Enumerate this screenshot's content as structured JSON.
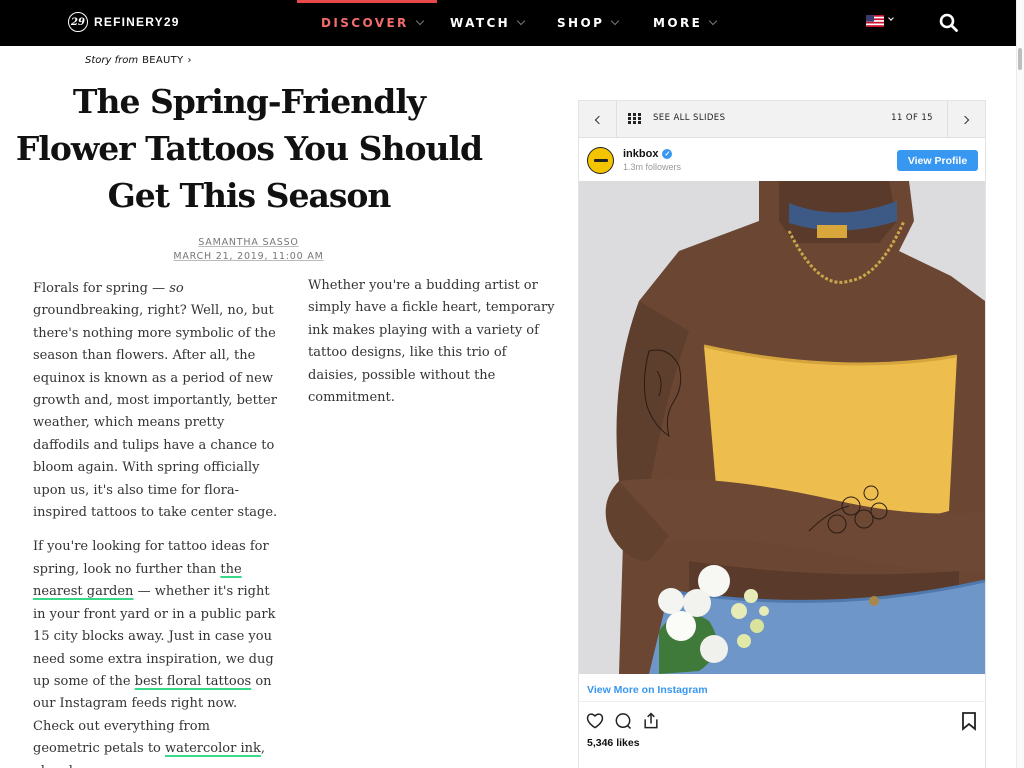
{
  "brand": {
    "logo_mark": "29",
    "name": "REFINERY29"
  },
  "nav": {
    "items": [
      {
        "label": "DISCOVER",
        "active": true
      },
      {
        "label": "WATCH",
        "active": false
      },
      {
        "label": "SHOP",
        "active": false
      },
      {
        "label": "MORE",
        "active": false
      }
    ],
    "locale_icon": "us-flag-icon",
    "search_icon": "search-icon",
    "accent_color": "#f36c6c"
  },
  "article": {
    "story_from_prefix": "Story from",
    "story_from_category": "BEAUTY",
    "headline": "The Spring-Friendly Flower Tattoos You Should Get This Season",
    "author": "SAMANTHA SASSO",
    "date": "MARCH 21, 2019, 11:00 AM",
    "col1_p1": "Florals for spring — so groundbreaking, right? Well, no, but there's nothing more symbolic of the season than flowers. After all, the equinox is known as a period of new growth and, most importantly, better weather, which means pretty daffodils and tulips have a chance to bloom again. With spring officially upon us, it's also time for flora-inspired tattoos to take center stage.",
    "col1_p1_parts": {
      "a": "Florals for spring — ",
      "b": "so",
      "c": " groundbreaking, right? Well, no, but there's nothing more symbolic of the season than flowers. After all, the equinox is known as a period of new growth and, most importantly, better weather, which means pretty daffodils and tulips have a chance to bloom again. With spring officially upon us, it's also time for flora-inspired tattoos to take center stage."
    },
    "col1_p2_parts": {
      "a": "If you're looking for tattoo ideas for spring, look no further than ",
      "link1": "the nearest garden",
      "b": " — whether it's right in your front yard or in a public park 15 city blocks away. Just in case you need some extra inspiration, we dug up some of the ",
      "link2": "best floral tattoos",
      "c": " on our Instagram feeds right now. Check out everything from geometric petals to ",
      "link3": "watercolor ink",
      "d": ", ahead."
    },
    "col2": "Whether you're a budding artist or simply have a fickle heart, temporary ink makes playing with a variety of tattoo designs, like this trio of daisies, possible without the commitment.",
    "link_underline_color": "#39d98a"
  },
  "slideshow": {
    "see_all_label": "SEE ALL SLIDES",
    "current": 11,
    "total": 15,
    "counter_label": "11 OF 15",
    "instagram": {
      "username": "inkbox",
      "verified": true,
      "followers": "1.3m followers",
      "view_profile_label": "View Profile",
      "view_more_label": "View More on Instagram",
      "likes": "5,346 likes",
      "accent_color": "#3897f0"
    }
  }
}
